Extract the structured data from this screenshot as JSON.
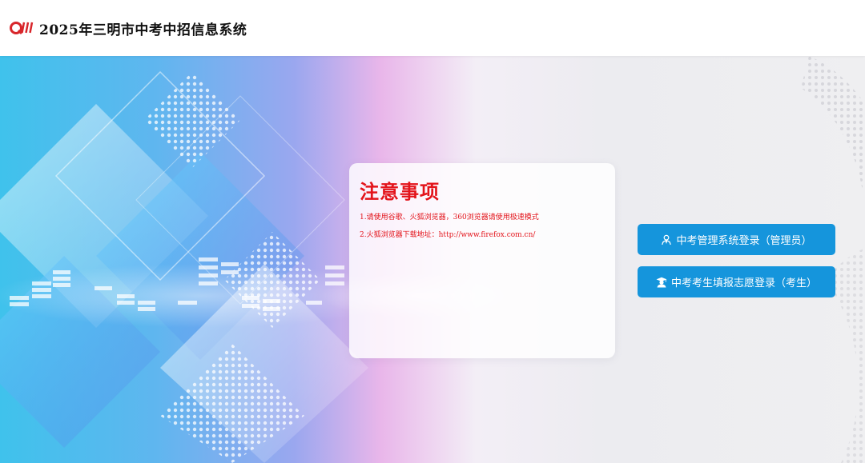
{
  "header": {
    "logo_text": "QW",
    "title": "2025年三明市中考中招信息系统"
  },
  "notice": {
    "title": "注意事项",
    "lines": [
      "1.请使用谷歌、火狐浏览器，360浏览器请使用极速模式",
      "2.火狐浏览器下载地址：http://www.firefox.com.cn/"
    ]
  },
  "buttons": {
    "admin_login": "中考管理系统登录（管理员）",
    "student_login": "中考考生填报志愿登录（考生）"
  },
  "icons": {
    "admin": "user-outline-icon",
    "student": "graduate-icon"
  },
  "colors": {
    "accent": "#1595dc",
    "notice_red": "#e3141b",
    "logo_red": "#d8262b"
  }
}
